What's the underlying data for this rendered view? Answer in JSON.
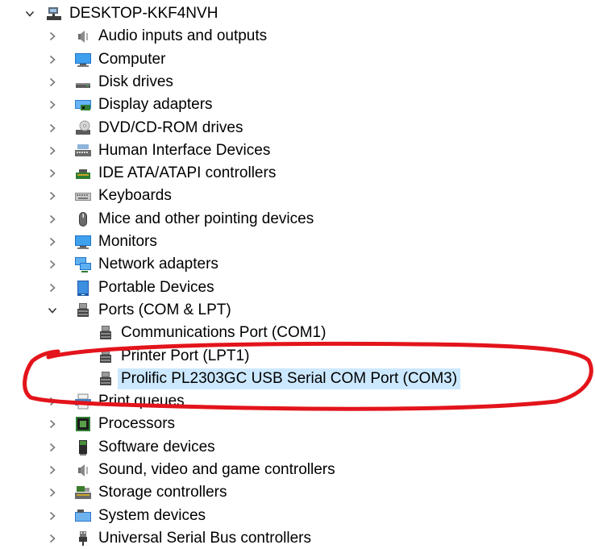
{
  "root": {
    "label": "DESKTOP-KKF4NVH",
    "icon": "computer-root-icon",
    "expanded": true
  },
  "categories": [
    {
      "label": "Audio inputs and outputs",
      "icon": "speaker-icon"
    },
    {
      "label": "Computer",
      "icon": "monitor-icon"
    },
    {
      "label": "Disk drives",
      "icon": "disk-drive-icon"
    },
    {
      "label": "Display adapters",
      "icon": "display-adapter-icon"
    },
    {
      "label": "DVD/CD-ROM drives",
      "icon": "dvd-drive-icon"
    },
    {
      "label": "Human Interface Devices",
      "icon": "hid-icon"
    },
    {
      "label": "IDE ATA/ATAPI controllers",
      "icon": "ide-controller-icon"
    },
    {
      "label": "Keyboards",
      "icon": "keyboard-icon"
    },
    {
      "label": "Mice and other pointing devices",
      "icon": "mouse-icon"
    },
    {
      "label": "Monitors",
      "icon": "monitor-icon"
    },
    {
      "label": "Network adapters",
      "icon": "network-adapter-icon"
    },
    {
      "label": "Portable Devices",
      "icon": "portable-device-icon"
    },
    {
      "label": "Ports (COM & LPT)",
      "icon": "port-icon",
      "expanded": true,
      "children": [
        {
          "label": "Communications Port (COM1)",
          "icon": "port-icon"
        },
        {
          "label": "Printer Port (LPT1)",
          "icon": "port-icon"
        },
        {
          "label": "Prolific PL2303GC USB Serial COM Port (COM3)",
          "icon": "port-icon",
          "selected": true
        }
      ]
    },
    {
      "label": "Print queues",
      "icon": "printer-icon"
    },
    {
      "label": "Processors",
      "icon": "processor-icon"
    },
    {
      "label": "Software devices",
      "icon": "software-device-icon"
    },
    {
      "label": "Sound, video and game controllers",
      "icon": "speaker-icon"
    },
    {
      "label": "Storage controllers",
      "icon": "storage-controller-icon"
    },
    {
      "label": "System devices",
      "icon": "system-devices-icon"
    },
    {
      "label": "Universal Serial Bus controllers",
      "icon": "usb-icon"
    }
  ],
  "annotation": {
    "shape": "ellipse",
    "color": "#e3141b"
  }
}
